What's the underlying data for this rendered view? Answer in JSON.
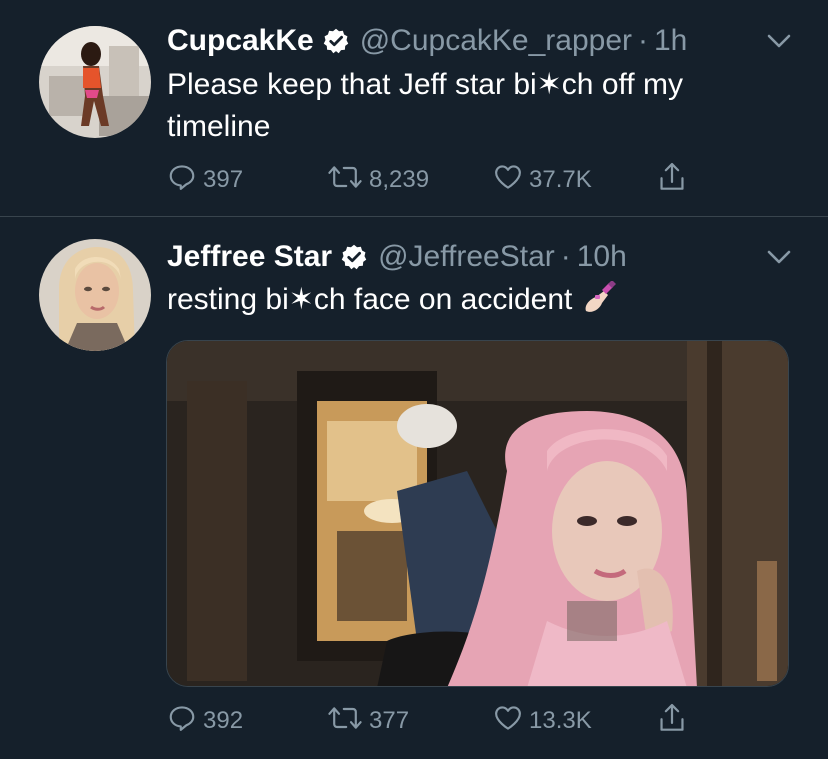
{
  "tweets": [
    {
      "display_name": "CupcakKe",
      "verified": true,
      "handle": "@CupcakKe_rapper",
      "separator": "·",
      "time": "1h",
      "text": "Please keep that Jeff star bi✶ch off my timeline",
      "text_html_parts": [
        "Please keep that Jeff star bi",
        "ch off my",
        "timeline"
      ],
      "replies": "397",
      "retweets": "8,239",
      "likes": "37.7K",
      "avatar_icon": "profile-photo"
    },
    {
      "display_name": "Jeffree Star",
      "verified": true,
      "handle": "@JeffreeStar",
      "separator": "·",
      "time": "10h",
      "text": "resting bi✶ch face on accident",
      "emoji": "nail-polish-emoji",
      "has_media": true,
      "media_icon": "photo",
      "replies": "392",
      "retweets": "377",
      "likes": "13.3K",
      "avatar_icon": "profile-photo"
    }
  ],
  "colors": {
    "background": "#15202b",
    "divider": "#38444d",
    "secondary_text": "#8899a6",
    "primary_text": "#ffffff"
  },
  "icons": {
    "reply": "reply-icon",
    "retweet": "retweet-icon",
    "like": "heart-icon",
    "share": "share-icon",
    "caret": "chevron-down-icon",
    "verified": "verified-badge-icon"
  }
}
